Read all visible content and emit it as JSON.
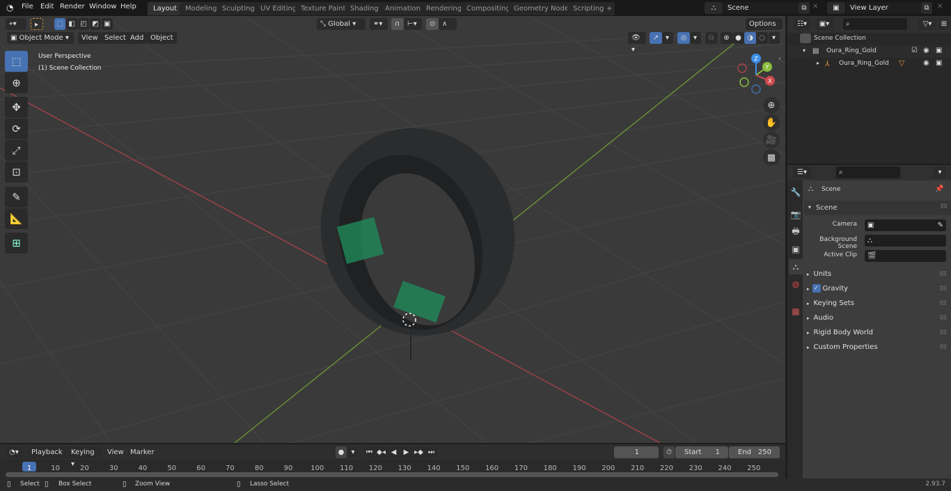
{
  "topbar": {
    "menus": [
      "File",
      "Edit",
      "Render",
      "Window",
      "Help"
    ],
    "workspace_tabs": [
      "Layout",
      "Modeling",
      "Sculpting",
      "UV Editing",
      "Texture Paint",
      "Shading",
      "Animation",
      "Rendering",
      "Compositing",
      "Geometry Nodes",
      "Scripting"
    ],
    "active_tab": "Layout",
    "add_tab": "+",
    "scene_name": "Scene",
    "view_layer_name": "View Layer"
  },
  "viewport": {
    "mode": "Object Mode",
    "header_menus": [
      "View",
      "Select",
      "Add",
      "Object"
    ],
    "transform_orientation": "Global",
    "options_label": "Options",
    "overlay_title": "User Perspective",
    "overlay_subtitle": "(1) Scene Collection",
    "gizmo_axes": [
      "Z",
      "Y",
      "X"
    ],
    "tools": [
      "select-box",
      "cursor",
      "move",
      "rotate",
      "scale",
      "transform",
      "annotate",
      "measure",
      "add-cube"
    ],
    "nav_buttons": [
      "zoom",
      "pan",
      "camera",
      "ortho-grid"
    ],
    "colors": {
      "x_axis": "#d0494f",
      "y_axis": "#8cbf3f",
      "z_axis": "#3d8ee8",
      "accent": "#4772b3"
    }
  },
  "outliner": {
    "root": "Scene Collection",
    "items": [
      {
        "label": "Oura_Ring_Gold",
        "type": "collection",
        "checked": true
      },
      {
        "label": "Oura_Ring_Gold",
        "type": "object"
      }
    ]
  },
  "properties": {
    "context": "Scene",
    "panel_title": "Scene",
    "fields": [
      {
        "label": "Camera",
        "value": ""
      },
      {
        "label": "Background Scene",
        "value": ""
      },
      {
        "label": "Active Clip",
        "value": ""
      }
    ],
    "sections": [
      {
        "label": "Units"
      },
      {
        "label": "Gravity",
        "checkbox": true
      },
      {
        "label": "Keying Sets"
      },
      {
        "label": "Audio"
      },
      {
        "label": "Rigid Body World"
      },
      {
        "label": "Custom Properties"
      }
    ]
  },
  "timeline": {
    "menus": [
      "Playback",
      "Keying",
      "View",
      "Marker"
    ],
    "current_frame": "1",
    "start_label": "Start",
    "start": "1",
    "end_label": "End",
    "end": "250",
    "ticks": [
      "1",
      "10",
      "20",
      "30",
      "40",
      "50",
      "60",
      "70",
      "80",
      "90",
      "100",
      "110",
      "120",
      "130",
      "140",
      "150",
      "160",
      "170",
      "180",
      "190",
      "200",
      "210",
      "220",
      "230",
      "240",
      "250"
    ]
  },
  "statusbar": {
    "hints": [
      "Select",
      "Box Select",
      "Zoom View",
      "Lasso Select"
    ],
    "version": "2.93.7"
  }
}
